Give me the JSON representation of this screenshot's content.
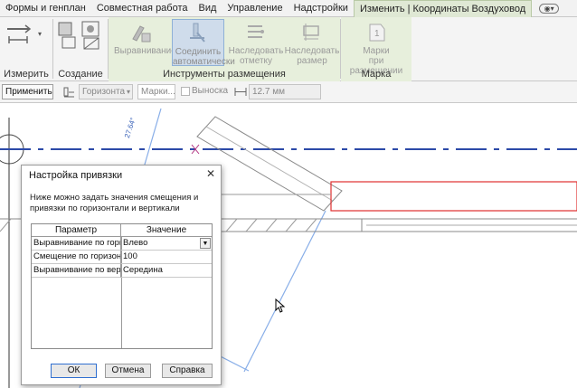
{
  "ribbon": {
    "tabs": [
      {
        "label": "Формы и генплан",
        "active": false
      },
      {
        "label": "Совместная работа",
        "active": false
      },
      {
        "label": "Вид",
        "active": false
      },
      {
        "label": "Управление",
        "active": false
      },
      {
        "label": "Надстройки",
        "active": false
      },
      {
        "label": "Изменить | Координаты Воздуховод",
        "active": true
      }
    ],
    "panels": {
      "measure_label": "Измерить",
      "create_label": "Создание",
      "placement_tools_label": "Инструменты размещения",
      "mark_label": "Марка"
    },
    "buttons": {
      "align": "Выравнивание",
      "auto_connect_line1": "Соединить",
      "auto_connect_line2": "автоматически",
      "inherit_elev_line1": "Наследовать",
      "inherit_elev_line2": "отметку",
      "inherit_size_line1": "Наследовать",
      "inherit_size_line2": "размер",
      "tag_on_place_line1": "Марки",
      "tag_on_place_line2": "при размещении"
    }
  },
  "options_bar": {
    "apply_label": "Применить",
    "orientation_value": "Горизонта",
    "marks_placeholder": "Марки...",
    "callout_label": "Выноска",
    "length_value": "12.7 мм"
  },
  "drawing": {
    "dimension_text": "27.64°"
  },
  "dialog": {
    "title": "Настройка привязки",
    "description": "Ниже можно задать значения смещения и привязки по горизонтали и вертикали",
    "columns": [
      "Параметр",
      "Значение"
    ],
    "rows": [
      {
        "param": "Выравнивание по гори",
        "value": "Влево"
      },
      {
        "param": "Смещение по горизон",
        "value": "100"
      },
      {
        "param": "Выравнивание по верт",
        "value": "Середина"
      }
    ],
    "ok_label": "ОК",
    "cancel_label": "Отмена",
    "help_label": "Справка"
  },
  "colors": {
    "accent_blue": "#3a62b8",
    "selected_red": "#e03030",
    "ribbon_green": "#e7efdc"
  }
}
